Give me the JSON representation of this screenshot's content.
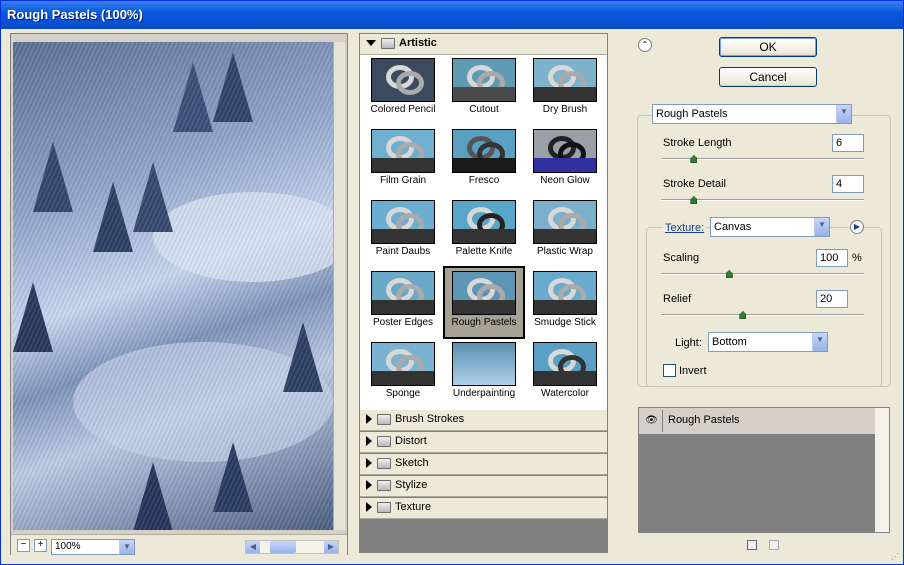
{
  "window": {
    "title": "Rough Pastels (100%)"
  },
  "preview": {
    "zoom": "100%",
    "zoom_out_symbol": "−",
    "zoom_in_symbol": "+"
  },
  "gallery": {
    "open_category": "Artistic",
    "filters": [
      {
        "label": "Colored Pencil"
      },
      {
        "label": "Cutout"
      },
      {
        "label": "Dry Brush"
      },
      {
        "label": "Film Grain"
      },
      {
        "label": "Fresco"
      },
      {
        "label": "Neon Glow"
      },
      {
        "label": "Paint Daubs"
      },
      {
        "label": "Palette Knife"
      },
      {
        "label": "Plastic Wrap"
      },
      {
        "label": "Poster Edges"
      },
      {
        "label": "Rough Pastels",
        "selected": true
      },
      {
        "label": "Smudge Stick"
      },
      {
        "label": "Sponge"
      },
      {
        "label": "Underpainting"
      },
      {
        "label": "Watercolor"
      }
    ],
    "closed_categories": [
      "Brush Strokes",
      "Distort",
      "Sketch",
      "Stylize",
      "Texture"
    ]
  },
  "buttons": {
    "ok": "OK",
    "cancel": "Cancel"
  },
  "settings": {
    "filter": "Rough Pastels",
    "stroke_length_label": "Stroke Length",
    "stroke_length": "6",
    "stroke_length_level": 0.15,
    "stroke_detail_label": "Stroke Detail",
    "stroke_detail": "4",
    "stroke_detail_level": 0.15,
    "texture_label": "Texture:",
    "texture": "Canvas",
    "scaling_label": "Scaling",
    "scaling": "100",
    "scaling_unit": "%",
    "scaling_level": 0.33,
    "relief_label": "Relief",
    "relief": "20",
    "relief_level": 0.4,
    "light_label": "Light:",
    "light": "Bottom",
    "invert_label": "Invert",
    "invert_checked": false
  },
  "layers": [
    {
      "name": "Rough Pastels"
    }
  ],
  "colors": {
    "titlebar": "#0a5bde",
    "selection": "#a7a296",
    "slider_knob": "#2e7d32"
  }
}
